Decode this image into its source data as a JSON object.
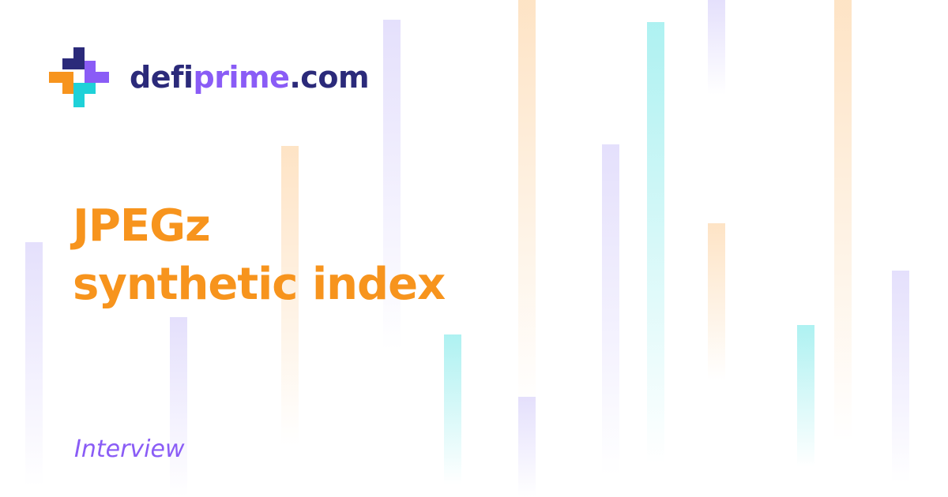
{
  "brand": {
    "name_part1": "defi",
    "name_part2": "prime",
    "name_part3": ".com",
    "logo_icon": "plus-blocks-logo-icon",
    "colors": {
      "navy": "#2b2a7a",
      "purple": "#8a5cf6",
      "orange": "#f7941d",
      "cyan": "#1fd1d8"
    }
  },
  "article": {
    "title_line1": "JPEGz",
    "title_line2": "synthetic index",
    "category": "Interview"
  }
}
